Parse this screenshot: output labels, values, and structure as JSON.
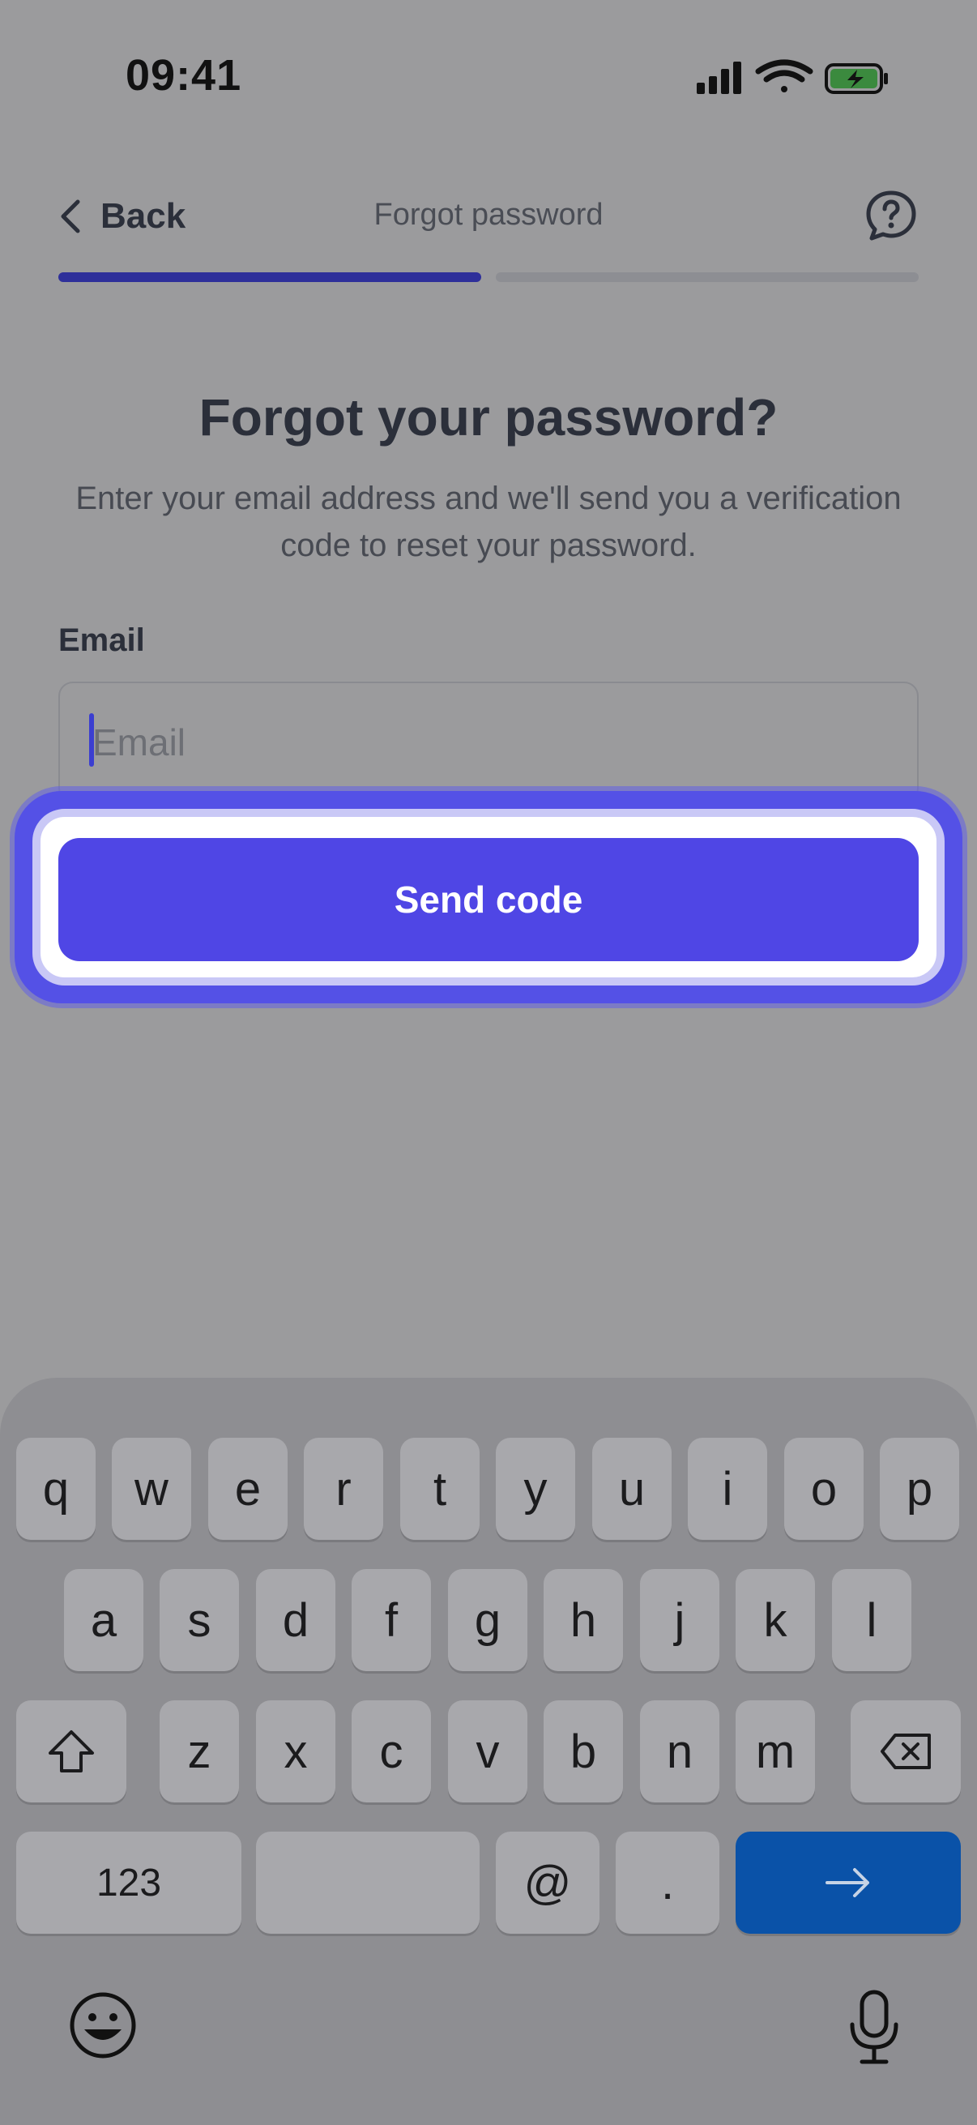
{
  "status_bar": {
    "time": "09:41"
  },
  "header": {
    "back_label": "Back",
    "title": "Forgot password",
    "help_icon": "help-chat-icon"
  },
  "progress": {
    "step": 1,
    "total": 2,
    "active_color": "#2e2f9a"
  },
  "content": {
    "heading": "Forgot your password?",
    "description": "Enter your email address and we'll send you a verification code to reset your password.",
    "email_label": "Email",
    "email_placeholder": "Email",
    "email_value": "",
    "send_button": "Send code"
  },
  "keyboard": {
    "row1": [
      "q",
      "w",
      "e",
      "r",
      "t",
      "y",
      "u",
      "i",
      "o",
      "p"
    ],
    "row2": [
      "a",
      "s",
      "d",
      "f",
      "g",
      "h",
      "j",
      "k",
      "l"
    ],
    "row3": [
      "z",
      "x",
      "c",
      "v",
      "b",
      "n",
      "m"
    ],
    "numbers_key": "123",
    "at_key": "@",
    "dot_key": ".",
    "icons": [
      "shift-icon",
      "backspace-icon",
      "return-arrow-icon",
      "emoji-icon",
      "microphone-icon"
    ]
  },
  "colors": {
    "primary": "#4f46e5",
    "return_key": "#0a52a8"
  }
}
